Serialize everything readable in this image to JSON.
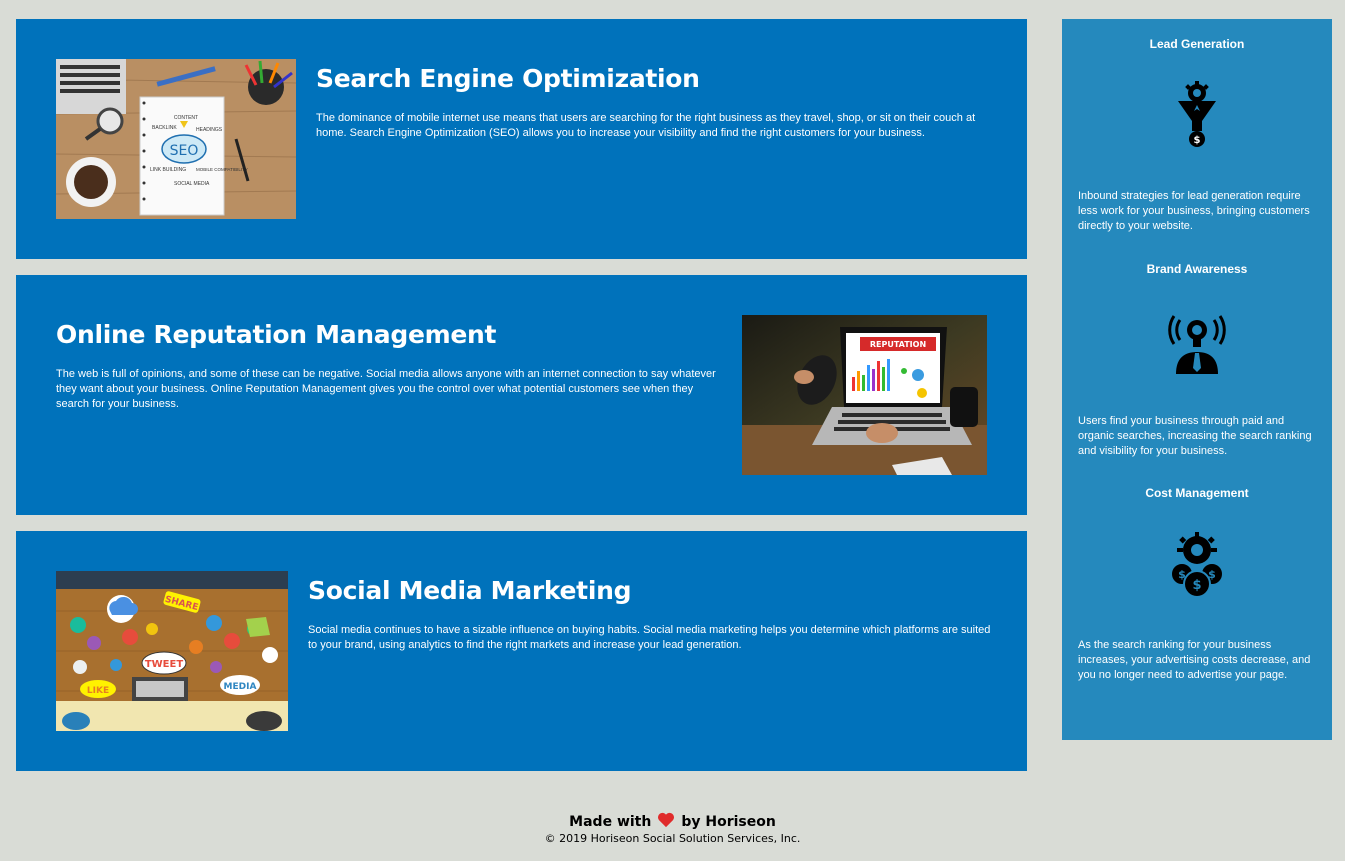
{
  "sections": [
    {
      "id": "search-engine-optimization",
      "title": "Search Engine Optimization",
      "text": "The dominance of mobile internet use means that users are searching for the right business as they travel, shop, or sit on their couch at home. Search Engine Optimization (SEO) allows you to increase your visibility and find the right customers for your business.",
      "image_labels": [
        "SEO",
        "CONTENT",
        "BACKLINK",
        "HEADINGS",
        "LINK BUILDING",
        "MOBILE COMPATIBILITY",
        "SOCIAL MEDIA"
      ]
    },
    {
      "id": "online-reputation-management",
      "title": "Online Reputation Management",
      "text": "The web is full of opinions, and some of these can be negative. Social media allows anyone with an internet connection to say whatever they want about your business. Online Reputation Management gives you the control over what potential customers see when they search for your business.",
      "image_labels": [
        "REPUTATION"
      ]
    },
    {
      "id": "social-media-marketing",
      "title": "Social Media Marketing",
      "text": "Social media continues to have a sizable influence on buying habits. Social media marketing helps you determine which platforms are suited to your brand, using analytics to find the right markets and increase your lead generation.",
      "image_labels": [
        "SHARE",
        "TWEET",
        "LIKE",
        "MEDIA"
      ]
    }
  ],
  "benefits": [
    {
      "title": "Lead Generation",
      "icon": "lead-generation-icon",
      "text": "Inbound strategies for lead generation require less work for your business, bringing customers directly to your website."
    },
    {
      "title": "Brand Awareness",
      "icon": "brand-awareness-icon",
      "text": "Users find your business through paid and organic searches, increasing the search ranking and visibility for your business."
    },
    {
      "title": "Cost Management",
      "icon": "cost-management-icon",
      "text": "As the search ranking for your business increases, your advertising costs decrease, and you no longer need to advertise your page."
    }
  ],
  "footer": {
    "made_with": "Made with",
    "by": "by Horiseon",
    "copyright": "© 2019 Horiseon Social Solution Services, Inc."
  },
  "colors": {
    "page_background": "#d9dcd6",
    "section_background": "#0072bb",
    "sidebar_background": "#2589bd",
    "heart": "#e02b2b"
  }
}
